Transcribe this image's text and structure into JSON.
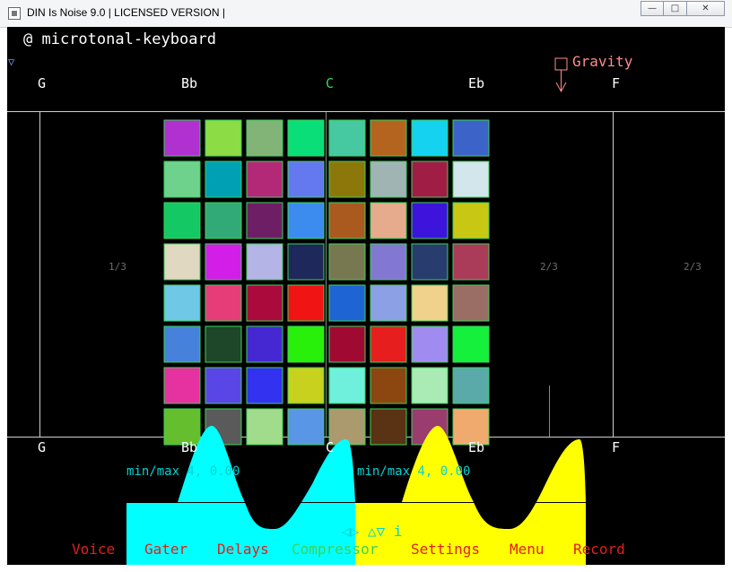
{
  "window": {
    "title": "DIN Is Noise 9.0 | LICENSED VERSION |",
    "buttons": {
      "minimize": "—",
      "maximize": "□",
      "close": "✕"
    }
  },
  "header": {
    "mode": "@ microtonal-keyboard",
    "dropdown": "▽",
    "gravity": "Gravity"
  },
  "scale": {
    "top": [
      "G",
      "Bb",
      "C",
      "Eb",
      "F"
    ],
    "bottom": [
      "G",
      "Bb",
      "C",
      "Eb",
      "F"
    ]
  },
  "ratios": [
    "1/3",
    "2/3",
    "2/3"
  ],
  "minmax": [
    "min/max 4, 0.00",
    "min/max 4, 0.00"
  ],
  "arrows": "◁▷ △▽ i",
  "menu": [
    {
      "label": "Voice",
      "color": "#e0201c"
    },
    {
      "label": "Gater",
      "color": "#e0201c"
    },
    {
      "label": "Delays",
      "color": "#e0201c"
    },
    {
      "label": "Compressor",
      "color": "#3cd25a"
    },
    {
      "label": "Settings",
      "color": "#e0201c"
    },
    {
      "label": "Menu",
      "color": "#e0201c"
    },
    {
      "label": "Record",
      "color": "#e0201c"
    }
  ],
  "grid_colors": [
    [
      "#b030d0",
      "#8cdc46",
      "#82b478",
      "#0ade78",
      "#46c8a0",
      "#b4641e",
      "#14d2f0",
      "#3c64c8"
    ],
    [
      "#6ed28c",
      "#00a0b4",
      "#b42878",
      "#6478f0",
      "#8c780a",
      "#a0b4b4",
      "#a01e46",
      "#d2e6ec"
    ],
    [
      "#14c864",
      "#32aa78",
      "#6e1e64",
      "#3c8cf0",
      "#aa5a1e",
      "#e6aa8c",
      "#3c14dc",
      "#c8c814"
    ],
    [
      "#e0d8c0",
      "#d21ee6",
      "#b4b4e6",
      "#1e285a",
      "#787850",
      "#8278d2",
      "#283c6e",
      "#aa3c5a"
    ],
    [
      "#6ec8e6",
      "#e63c78",
      "#aa0a3c",
      "#f01414",
      "#1e64d2",
      "#8ca0e6",
      "#f0d28c",
      "#9a6e64"
    ],
    [
      "#4682dc",
      "#1e4628",
      "#4628d2",
      "#28f00a",
      "#a00a32",
      "#e61e1e",
      "#a08cf0",
      "#14f03c"
    ],
    [
      "#e632a0",
      "#5a46e6",
      "#3232f0",
      "#c8d21e",
      "#6ef0dc",
      "#8c4610",
      "#aaeab4",
      "#5aaaaa"
    ],
    [
      "#64be2d",
      "#5a5a5a",
      "#a0dc8c",
      "#5a96e6",
      "#aa9a6e",
      "#5a3214",
      "#9a3c6e",
      "#f0aa6e"
    ]
  ]
}
